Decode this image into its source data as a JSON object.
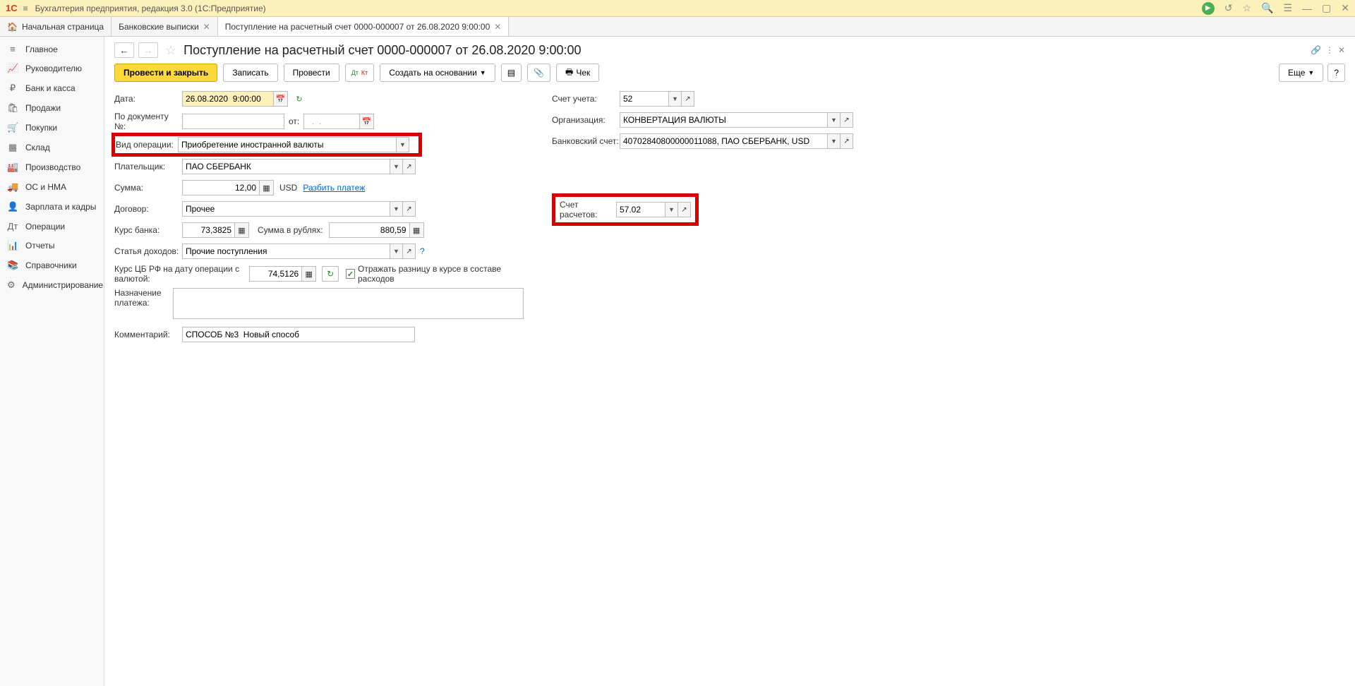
{
  "titlebar": {
    "logo": "1C",
    "title": "Бухгалтерия предприятия, редакция 3.0  (1С:Предприятие)"
  },
  "tabs": {
    "home": "Начальная страница",
    "t1": "Банковские выписки",
    "t2": "Поступление на расчетный счет 0000-000007 от 26.08.2020 9:00:00"
  },
  "sidebar": [
    {
      "icon": "≡",
      "label": "Главное"
    },
    {
      "icon": "📈",
      "label": "Руководителю"
    },
    {
      "icon": "₽",
      "label": "Банк и касса"
    },
    {
      "icon": "🛍",
      "label": "Продажи"
    },
    {
      "icon": "🛒",
      "label": "Покупки"
    },
    {
      "icon": "▦",
      "label": "Склад"
    },
    {
      "icon": "🏭",
      "label": "Производство"
    },
    {
      "icon": "🚚",
      "label": "ОС и НМА"
    },
    {
      "icon": "👤",
      "label": "Зарплата и кадры"
    },
    {
      "icon": "Дт",
      "label": "Операции"
    },
    {
      "icon": "📊",
      "label": "Отчеты"
    },
    {
      "icon": "📚",
      "label": "Справочники"
    },
    {
      "icon": "⚙",
      "label": "Администрирование"
    }
  ],
  "page": {
    "title": "Поступление на расчетный счет 0000-000007 от 26.08.2020 9:00:00"
  },
  "toolbar": {
    "post_close": "Провести и закрыть",
    "save": "Записать",
    "post": "Провести",
    "create_based": "Создать на основании",
    "cheque": "Чек",
    "more": "Еще",
    "help": "?"
  },
  "labels": {
    "date": "Дата:",
    "doc_num": "По документу №:",
    "from": "от:",
    "operation_type": "Вид операции:",
    "payer": "Плательщик:",
    "amount": "Сумма:",
    "currency": "USD",
    "split": "Разбить платеж",
    "contract": "Договор:",
    "bank_rate": "Курс банка:",
    "amount_rub": "Сумма в рублях:",
    "income_item": "Статья доходов:",
    "cb_rate": "Курс ЦБ РФ на дату операции с валютой:",
    "reflect_diff": "Отражать разницу в курсе в составе расходов",
    "purpose": "Назначение платежа:",
    "comment": "Комментарий:",
    "account": "Счет учета:",
    "organization": "Организация:",
    "bank_account": "Банковский счет:",
    "settlement_acct": "Счет расчетов:"
  },
  "values": {
    "date": "26.08.2020  9:00:00",
    "doc_num": "",
    "from": "  .  .    ",
    "operation_type": "Приобретение иностранной валюты",
    "payer": "ПАО СБЕРБАНК",
    "amount": "12,00",
    "contract": "Прочее",
    "bank_rate": "73,3825",
    "amount_rub": "880,59",
    "income_item": "Прочие поступления",
    "cb_rate": "74,5126",
    "purpose": "",
    "comment": "СПОСОБ №3  Новый способ",
    "account": "52",
    "organization": "КОНВЕРТАЦИЯ ВАЛЮТЫ",
    "bank_account": "40702840800000011088, ПАО СБЕРБАНК, USD",
    "settlement_acct": "57.02"
  }
}
